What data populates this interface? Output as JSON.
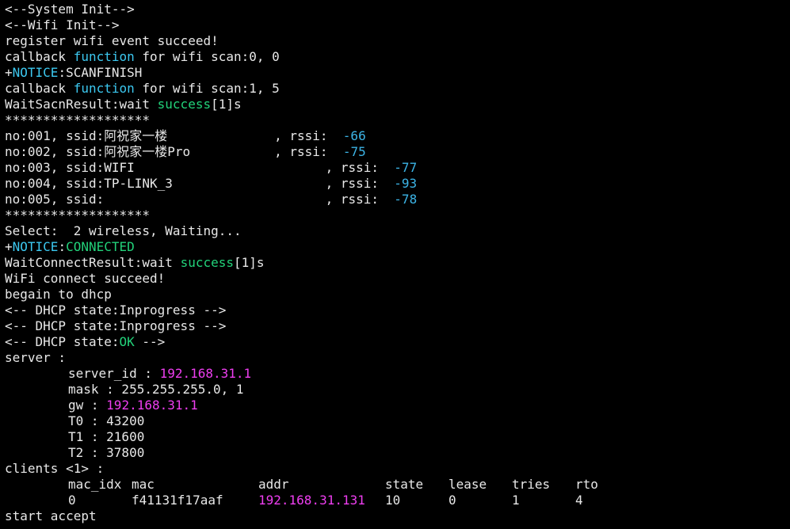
{
  "lines": {
    "system_init": "<--System Init-->",
    "wifi_init": "<--Wifi Init-->",
    "register_event": "register wifi event succeed!",
    "callback1_a": "callback ",
    "callback1_fn": "function",
    "callback1_b": " for wifi scan:0, 0",
    "notice1_plus": "+",
    "notice1_key": "NOTICE",
    "notice1_val": ":SCANFINISH",
    "callback2_a": "callback ",
    "callback2_fn": "function",
    "callback2_b": " for wifi scan:1, 5",
    "wait_scan_a": "WaitSacnResult:wait ",
    "wait_scan_ok": "success",
    "wait_scan_b": "[1]s",
    "stars1": "*******************",
    "stars2": "*******************",
    "select": "Select:  2 wireless, Waiting...",
    "notice2_plus": "+",
    "notice2_key": "NOTICE",
    "notice2_colon": ":",
    "notice2_val": "CONNECTED",
    "wait_conn_a": "WaitConnectResult:wait ",
    "wait_conn_ok": "success",
    "wait_conn_b": "[1]s",
    "wifi_connect": "WiFi connect succeed!",
    "begin_dhcp": "begain to dhcp",
    "dhcp1": "<-- DHCP state:Inprogress -->",
    "dhcp2": "<-- DHCP state:Inprogress -->",
    "dhcp3_a": "<-- DHCP state:",
    "dhcp3_ok": "OK",
    "dhcp3_b": " -->",
    "server": "server :",
    "server_id_label": "server_id : ",
    "server_id_val": "192.168.31.1",
    "mask": "mask : 255.255.255.0, 1",
    "gw_label": "gw : ",
    "gw_val": "192.168.31.1",
    "t0": "T0 : 43200",
    "t1": "T1 : 21600",
    "t2": "T2 : 37800",
    "clients": "clients <1> :",
    "start_accept": "start accept"
  },
  "scan_results": [
    {
      "no": "no:001, ssid:阿祝家一楼",
      "pad": "              ",
      "rssi_label": ", rssi:  ",
      "rssi": "-66"
    },
    {
      "no": "no:002, ssid:阿祝家一楼Pro",
      "pad": "           ",
      "rssi_label": ", rssi:  ",
      "rssi": "-75"
    },
    {
      "no": "no:003, ssid:WIFI",
      "pad": "                         ",
      "rssi_label": ", rssi:  ",
      "rssi": "-77"
    },
    {
      "no": "no:004, ssid:TP-LINK_3",
      "pad": "                    ",
      "rssi_label": ", rssi:  ",
      "rssi": "-93"
    },
    {
      "no": "no:005, ssid:",
      "pad": "                             ",
      "rssi_label": ", rssi:  ",
      "rssi": "-78"
    }
  ],
  "clients_table": {
    "headers": [
      "mac_idx",
      "mac",
      "addr",
      "state",
      "lease",
      "tries",
      "rto"
    ],
    "row": [
      "0",
      "f41131f17aaf",
      "192.168.31.131",
      "10",
      "0",
      "1",
      "4"
    ]
  },
  "colors": {
    "background": "#000000",
    "text": "#e8e8e8",
    "keyword": "#3cc8f0",
    "success": "#22d27a",
    "ip": "#ee3ef0",
    "rssi": "#3cb4e6"
  }
}
